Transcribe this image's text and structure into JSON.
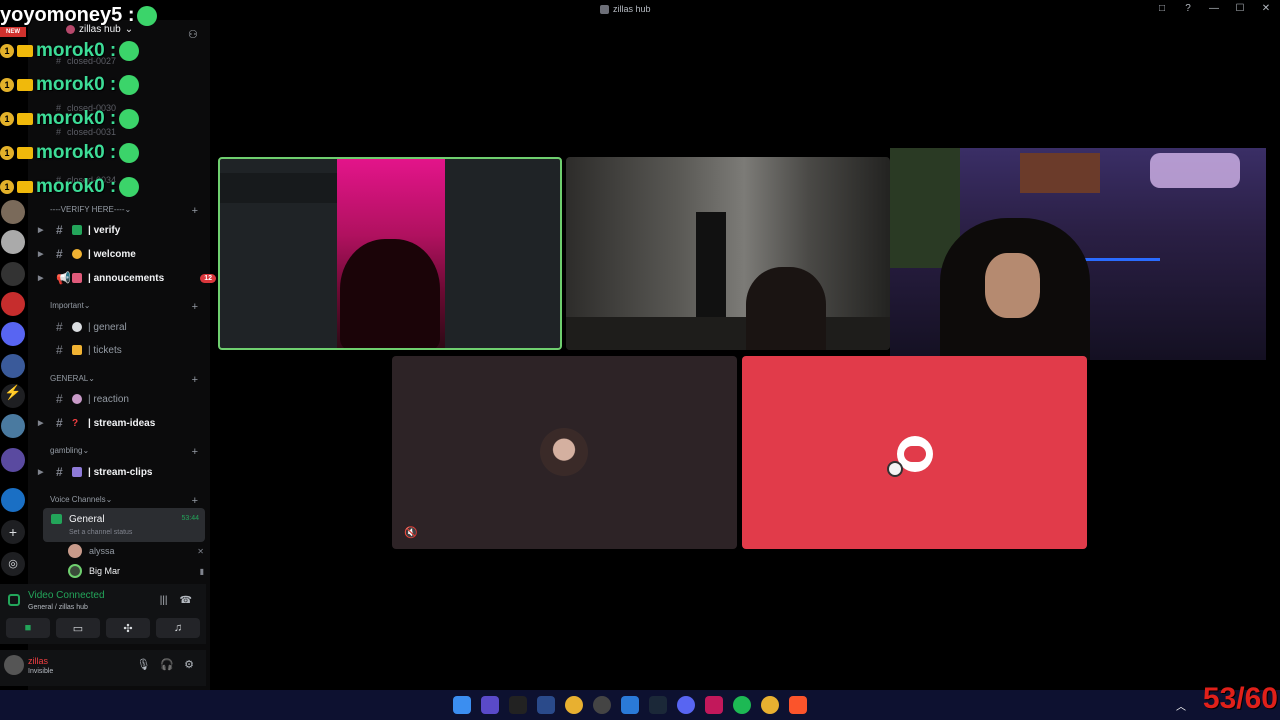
{
  "window": {
    "title": "zillas hub",
    "controls": [
      "□",
      "?",
      "—",
      "☐",
      "✕"
    ]
  },
  "server": {
    "name": "zillas hub",
    "add_member_icon": "add-member-icon"
  },
  "stream_chat": {
    "top_user": "yoyomoney5 :",
    "new_tag": "NEW",
    "lines": [
      {
        "badge": "1",
        "name": "morok0 :"
      },
      {
        "badge": "1",
        "name": "morok0 :"
      },
      {
        "badge": "1",
        "name": "morok0 :"
      },
      {
        "badge": "1",
        "name": "morok0 :"
      },
      {
        "badge": "1",
        "name": "morok0 :"
      }
    ]
  },
  "closed_channels": [
    "closed-0027",
    "closed-0030",
    "closed-0031",
    "closed-0034"
  ],
  "categories": {
    "verify": "----VERIFY HERE----",
    "important": "Important",
    "general": "GENERAL",
    "gambling": "gambling",
    "voice": "Voice Channels"
  },
  "channels": {
    "verify": "| verify",
    "welcome": "| welcome",
    "annoucements": "| annoucements",
    "annoucements_badge": "12",
    "general": "| general",
    "tickets": "| tickets",
    "reaction": "| reaction",
    "stream_ideas": "| stream-ideas",
    "stream_clips": "| stream-clips"
  },
  "voice_channel": {
    "name": "General",
    "status": "Set a channel status",
    "timer": "53:44",
    "members": [
      {
        "name": "alyssa"
      },
      {
        "name": "Big Mar"
      }
    ]
  },
  "voice_panel": {
    "title": "Video Connected",
    "subtitle": "General / zillas hub",
    "buttons": [
      "camera",
      "screen-share",
      "activities",
      "soundboard"
    ]
  },
  "user": {
    "name": "zillas",
    "status": "Invisible"
  },
  "overlay": {
    "fps": "53/60"
  },
  "colors": {
    "speaking": "#6fcf6f",
    "danger": "#e13b4a",
    "online": "#23a55a"
  }
}
